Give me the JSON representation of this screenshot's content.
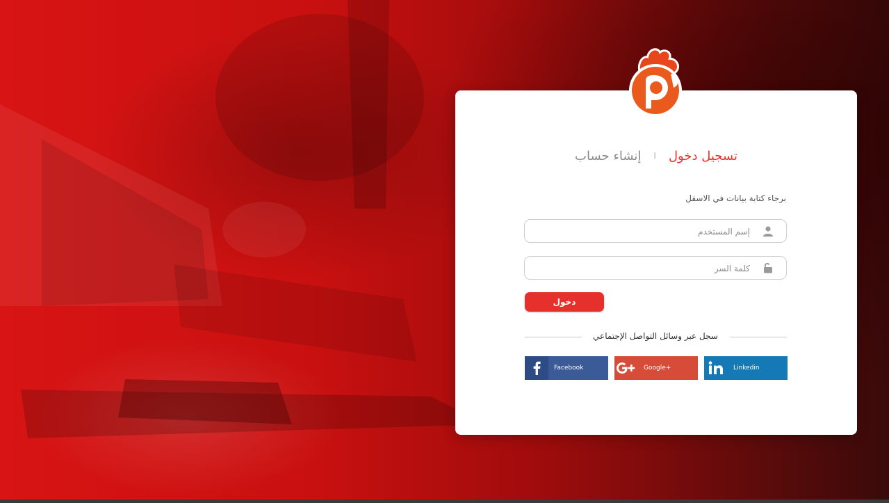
{
  "tabs": {
    "login": "تسجيل دخول",
    "separator": "I",
    "register": "إنشاء حساب"
  },
  "form": {
    "instructions": "برجاء كتابة بيانات في الاسفل",
    "username_placeholder": "إسم المستخدم",
    "password_placeholder": "كلمة السر",
    "submit_label": "دخول"
  },
  "social": {
    "heading": "سجل عبر وسائل التواصل الإجتماعي",
    "facebook_label": "Facebook",
    "google_label": "Google+",
    "linkedin_label": "Linkedin"
  },
  "icons": {
    "logo": "rooster-p-logo",
    "username": "user-icon",
    "password": "unlock-icon",
    "facebook": "facebook-icon",
    "google": "google-plus-icon",
    "linkedin": "linkedin-icon"
  },
  "colors": {
    "accent": "#e5302b",
    "facebook": "#3b5a98",
    "google": "#d74b39",
    "linkedin": "#1479b4"
  }
}
